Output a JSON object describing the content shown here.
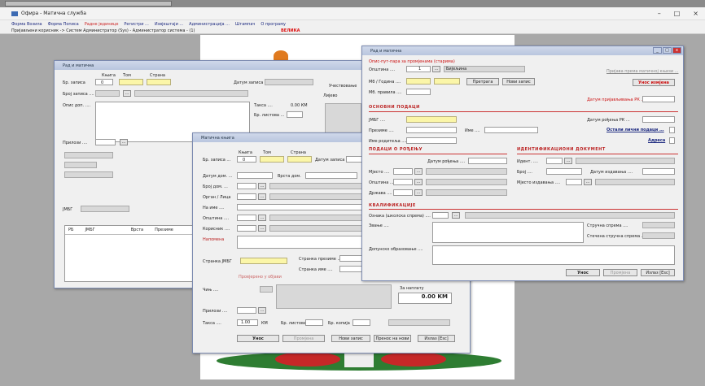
{
  "app": {
    "title": "Офира - Матична служба",
    "window_controls": [
      "–",
      "□",
      "×"
    ]
  },
  "menu": {
    "items": [
      "Форма Возила",
      "Форма Пописа",
      "Радне јединице",
      "Регистри ...",
      "Извјештаји ...",
      "Администрација ...",
      "Штампач",
      "О програму"
    ]
  },
  "crumb": {
    "left": "Пријављени корисник -> Систем Администратор (Sys) - Администратор система - (1)",
    "center": "ВЕЛИКА"
  },
  "win1": {
    "title": "Рад и матична",
    "broj_lbl": "Бр. записа",
    "broj_val": "0",
    "knjiga_lbl": "Књига",
    "tom_lbl": "Том",
    "strana_lbl": "Страна",
    "datum_lbl": "Датум записа",
    "broj_zapisa_lbl": "Број записа ....",
    "opis_lbl": "Опис доп. ....",
    "taksa_lbl": "Такса ....",
    "taksa_val": "0.00 КМ",
    "br_listova_lbl": "Бр. листова ...",
    "sudjelovanje_lbl": "Учествовање",
    "lijevo_lbl": "Лијево",
    "prilozi_lbl": "Прилози ....",
    "jmbg_lbl": "ЈМБГ",
    "col_rb": "РБ",
    "col_jmbg": "ЈМБГ",
    "col_vrsta": "Врста",
    "col_prezime": "Презиме"
  },
  "win2": {
    "title": "Матична књига",
    "knjiga_lbl": "Књига",
    "tom_lbl": "Том",
    "strana_lbl": "Страна",
    "broj_lbl": "Бр. записа ...",
    "broj_val": "0",
    "datum_lbl": "Датум записа",
    "datum_dom_lbl": "Датум дом. ...",
    "vrsta_lbl": "Врста дом.",
    "broj_dom_lbl": "Број дом. ...",
    "organ_lbl": "Орган / Лица",
    "na_ime_lbl": "На име ....",
    "opstina_lbl": "Општина ....",
    "korisnik_lbl": "Корисник ....",
    "napomena_lbl": "Напомена",
    "jmbg_lbl": "Странка ЈМБГ",
    "stranka_prezime_lbl": "Странка презиме ...",
    "stranka_ime_lbl": "Странка име ....",
    "checkbox_lbl": "Провјерено у објави",
    "cijeli_lbl": "Чињ ....",
    "za_naplatu_lbl": "За наплату",
    "za_naplatu_val": "0.00",
    "km": "КМ",
    "prilozi_lbl": "Прилози ....",
    "taksa_lbl": "Такса ....",
    "taksa_val": "1.00",
    "br_listova_lbl": "Бр. листова",
    "br_kopija_lbl": "Бр. копија",
    "btn_unos": "Унос",
    "btn_promjena": "Промјена",
    "btn_novi": "Нови запис",
    "btn_prenos": "Пренос на нови",
    "btn_izlaz": "Излаз [Esc]"
  },
  "win3": {
    "title": "Рад и матична",
    "top_note": "Опис-пут-пара за промјенама (старима)",
    "opstina_lbl": "Општина ....",
    "opstina_val": "1",
    "opstina_name": "Бијељина",
    "mb_lbl": "Мб / Година ....",
    "mb_list_lbl": "Мб. правила ....",
    "btn_pretraga": "Претрага",
    "btn_novi": "Нови запис",
    "link_top": "Пријава према матичној књизи ...",
    "red_unos": "Унос измјена",
    "datum_pr_lbl": "Датум пријављивања РК ...",
    "sec_osnovni": "ОСНОВНИ ПОДАЦИ",
    "jmbg_lbl": "ЈМБГ ....",
    "datum_rodj_lbl": "Датум рођења РК ...",
    "prezime_lbl": "Презиме ....",
    "ime_lbl": "Име ....",
    "link_ostali": "Остали лични подаци ...",
    "ime_roditelja_lbl": "Име родитеља ....",
    "adresa_link": "Адреса",
    "sec_podaci": "ПОДАЦИ О РОЂЕЊУ",
    "datum_rodjenja_lbl": "Датум рођења ....",
    "mjesto_lbl": "Мјесто ....",
    "opstina2_lbl": "Општина ....",
    "drzava_lbl": "Држава ....",
    "sec_ident": "ИДЕНТИФИКАЦИОНИ ДОКУМЕНТ",
    "ident_lbl": "Идент. ....",
    "broj_lbl": "Број ....",
    "datum_izdavanja_lbl": "Датум издавања ....",
    "mjesto_izd_lbl": "Мјесто издавања ....",
    "sec_kval": "КВАЛИФИКАЦИЈЕ",
    "sifra_lbl": "Ознака (школска спрема) ....",
    "zvanje_lbl": "Звање ....",
    "strucna_lbl": "Стручна спрема ....",
    "steceno_lbl": "Стечена стручна спрема ....",
    "dodatno_lbl": "Допунско образовање ....",
    "btn_unos": "Унос",
    "btn_promjena": "Промјена",
    "btn_izlaz": "Излаз [Esc]"
  },
  "colors": {
    "accent_red": "#b22222",
    "field_yellow": "#fbf6a8",
    "title_blue": "#1d2a80"
  }
}
